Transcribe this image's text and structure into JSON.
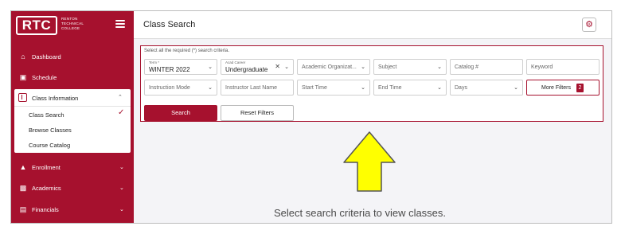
{
  "brand": {
    "logo": "RTC",
    "subtitle_lines": [
      "RENTON",
      "TECHNICAL",
      "COLLEGE"
    ]
  },
  "sidebar": {
    "items": [
      {
        "label": "Dashboard",
        "icon": "home-icon"
      },
      {
        "label": "Schedule",
        "icon": "calendar-icon"
      },
      {
        "label": "Class Information",
        "icon": "class-info-icon",
        "expanded": true,
        "children": [
          "Class Search",
          "Browse Classes",
          "Course Catalog"
        ]
      },
      {
        "label": "Enrollment",
        "icon": "graduation-cap-icon"
      },
      {
        "label": "Academics",
        "icon": "academics-icon"
      },
      {
        "label": "Financials",
        "icon": "financials-icon"
      }
    ],
    "active_child": "Class Search"
  },
  "header": {
    "title": "Class Search",
    "settings_icon": "gear-icon"
  },
  "criteria": {
    "note": "Select all the required (*) search criteria.",
    "term": {
      "label": "Term *",
      "value": "WINTER 2022"
    },
    "career": {
      "label": "Acad Career",
      "value": "Undergraduate"
    },
    "placeholders": {
      "academic_org": "Academic Organizat...",
      "subject": "Subject",
      "catalog": "Catalog #",
      "keyword": "Keyword",
      "instruction_mode": "Instruction Mode",
      "instructor": "Instructor Last Name",
      "start_time": "Start Time",
      "end_time": "End Time",
      "days": "Days"
    },
    "more_filters": {
      "label": "More Filters",
      "count": "2"
    },
    "search_label": "Search",
    "reset_label": "Reset Filters"
  },
  "empty_state": {
    "message": "Select search criteria to view classes."
  },
  "colors": {
    "brand": "#a6112e",
    "arrow_fill": "#ffff00",
    "arrow_stroke": "#555555"
  }
}
